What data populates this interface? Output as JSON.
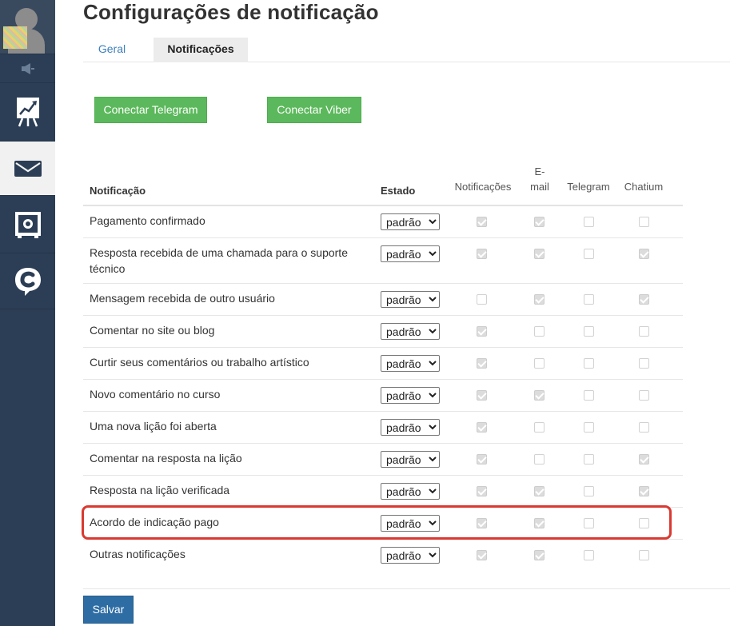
{
  "page": {
    "title": "Configurações de notificação"
  },
  "tabs": [
    {
      "label": "Geral"
    },
    {
      "label": "Notificações"
    }
  ],
  "connect": {
    "telegram_label": "Conectar Telegram",
    "viber_label": "Conectar Viber"
  },
  "table": {
    "headers": {
      "notification": "Notificação",
      "state": "Estado",
      "notifications": "Notificações",
      "email_line1": "E-",
      "email_line2": "mail",
      "telegram": "Telegram",
      "chatium": "Chatium"
    },
    "select_value": "padrão",
    "rows": [
      {
        "label": "Pagamento confirmado",
        "checks": [
          true,
          true,
          false,
          false
        ]
      },
      {
        "label": "Resposta recebida de uma chamada para o suporte técnico",
        "checks": [
          true,
          true,
          false,
          true
        ]
      },
      {
        "label": "Mensagem recebida de outro usuário",
        "checks": [
          false,
          true,
          false,
          true
        ]
      },
      {
        "label": "Comentar no site ou blog",
        "checks": [
          true,
          false,
          false,
          false
        ]
      },
      {
        "label": "Curtir seus comentários ou trabalho artístico",
        "checks": [
          true,
          false,
          false,
          false
        ]
      },
      {
        "label": "Novo comentário no curso",
        "checks": [
          true,
          true,
          false,
          false
        ]
      },
      {
        "label": "Uma nova lição foi aberta",
        "checks": [
          true,
          false,
          false,
          false
        ]
      },
      {
        "label": "Comentar na resposta na lição",
        "checks": [
          true,
          false,
          false,
          true
        ]
      },
      {
        "label": "Resposta na lição verificada",
        "checks": [
          true,
          true,
          false,
          true
        ]
      },
      {
        "label": "Acordo de indicação pago",
        "checks": [
          true,
          true,
          false,
          false
        ],
        "highlighted": true
      },
      {
        "label": "Outras notificações",
        "checks": [
          true,
          true,
          false,
          false
        ]
      }
    ]
  },
  "actions": {
    "save_label": "Salvar"
  },
  "colors": {
    "sidebar": "#2c3e55",
    "green": "#5cb85c",
    "save": "#2e6da4",
    "highlight": "#d93a32",
    "tab_link": "#3d7fbb"
  },
  "icons": [
    "avatar-icon",
    "megaphone-icon",
    "chart-board-icon",
    "mail-icon",
    "safe-icon",
    "chatium-icon"
  ]
}
